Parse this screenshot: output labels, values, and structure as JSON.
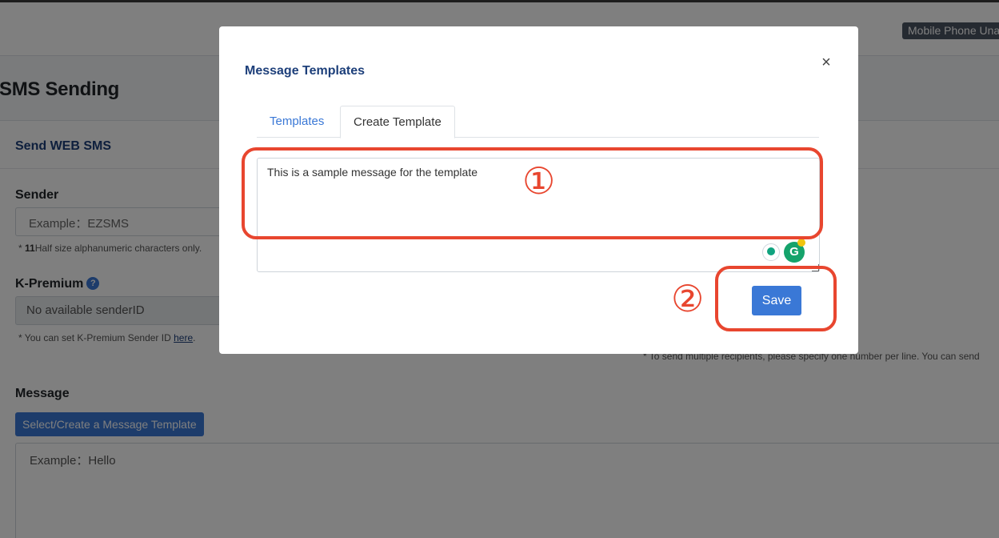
{
  "header": {
    "status_pill": "Mobile Phone Una"
  },
  "page": {
    "title": "SMS Sending",
    "card_title": "Send WEB SMS",
    "sender": {
      "label": "Sender",
      "placeholder": "Example：EZSMS",
      "help_prefix": "* ",
      "help_bold": "11",
      "help_rest": "Half size alphanumeric characters only."
    },
    "kpremium": {
      "label": "K-Premium",
      "help_icon": "?",
      "value": "No available senderID",
      "help_text": "* You can set K-Premium Sender ID ",
      "help_link": "here",
      "help_end": "."
    },
    "message": {
      "label": "Message",
      "template_button": "Select/Create a Message Template",
      "placeholder": "Example：Hello"
    },
    "recipients_note": "* To send multiple recipients, please specify one number per line. You can send"
  },
  "modal": {
    "title": "Message Templates",
    "close_icon": "×",
    "tabs": [
      {
        "label": "Templates",
        "active": false
      },
      {
        "label": "Create Template",
        "active": true
      }
    ],
    "textarea_value": "This is a sample message for the template",
    "save_label": "Save",
    "icons": [
      "lightbulb-icon",
      "grammarly-icon"
    ]
  },
  "annotations": {
    "step1": "①",
    "step2": "②",
    "color": "#e8462f"
  },
  "colors": {
    "accent": "#3a78d6",
    "title_navy": "#1d3f7a"
  }
}
